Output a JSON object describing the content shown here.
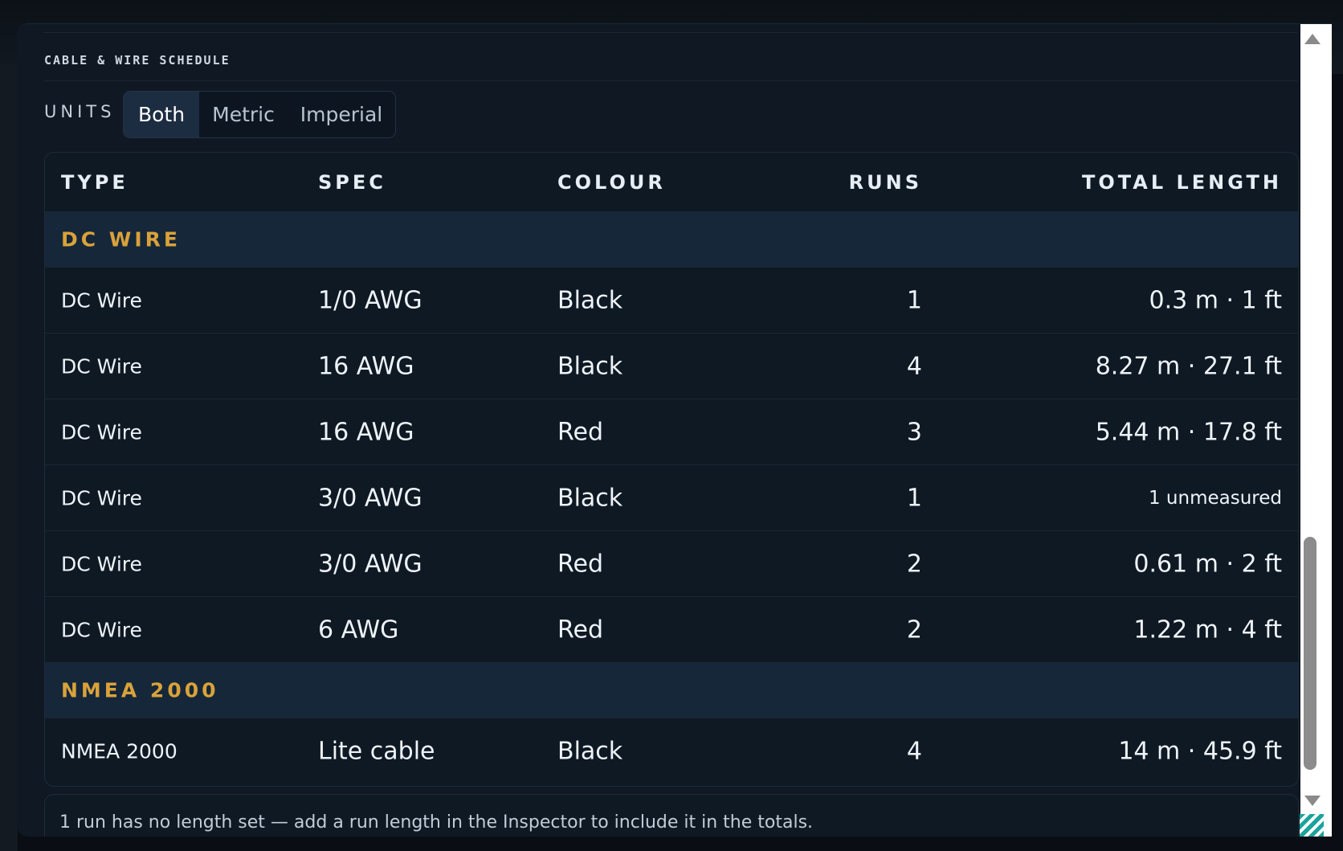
{
  "panel": {
    "title": "CABLE & WIRE SCHEDULE",
    "units_label": "UNITS",
    "unit_options": [
      "Both",
      "Metric",
      "Imperial"
    ],
    "unit_selected": "Both"
  },
  "table": {
    "headers": [
      "TYPE",
      "SPEC",
      "COLOUR",
      "RUNS",
      "TOTAL LENGTH"
    ],
    "groups": [
      {
        "label": "DC WIRE",
        "rows": [
          {
            "type": "DC Wire",
            "spec": "1/0 AWG",
            "colour": "Black",
            "runs": "1",
            "total": "0.3 m · 1 ft"
          },
          {
            "type": "DC Wire",
            "spec": "16 AWG",
            "colour": "Black",
            "runs": "4",
            "total": "8.27 m · 27.1 ft"
          },
          {
            "type": "DC Wire",
            "spec": "16 AWG",
            "colour": "Red",
            "runs": "3",
            "total": "5.44 m · 17.8 ft"
          },
          {
            "type": "DC Wire",
            "spec": "3/0 AWG",
            "colour": "Black",
            "runs": "1",
            "total": "1 unmeasured"
          },
          {
            "type": "DC Wire",
            "spec": "3/0 AWG",
            "colour": "Red",
            "runs": "2",
            "total": "0.61 m · 2 ft"
          },
          {
            "type": "DC Wire",
            "spec": "6 AWG",
            "colour": "Red",
            "runs": "2",
            "total": "1.22 m · 4 ft"
          }
        ]
      },
      {
        "label": "NMEA 2000",
        "rows": [
          {
            "type": "NMEA 2000",
            "spec": "Lite cable",
            "colour": "Black",
            "runs": "4",
            "total": "14 m · 45.9 ft"
          }
        ]
      }
    ]
  },
  "note": "1 run has no length set — add a run length in the Inspector to include it in the totals.",
  "colors": {
    "background": "#0f1823",
    "group_header_bg": "#152739",
    "group_label": "#d9a23a",
    "active_segment": "#1c2d42",
    "text": "#eef3f8"
  }
}
